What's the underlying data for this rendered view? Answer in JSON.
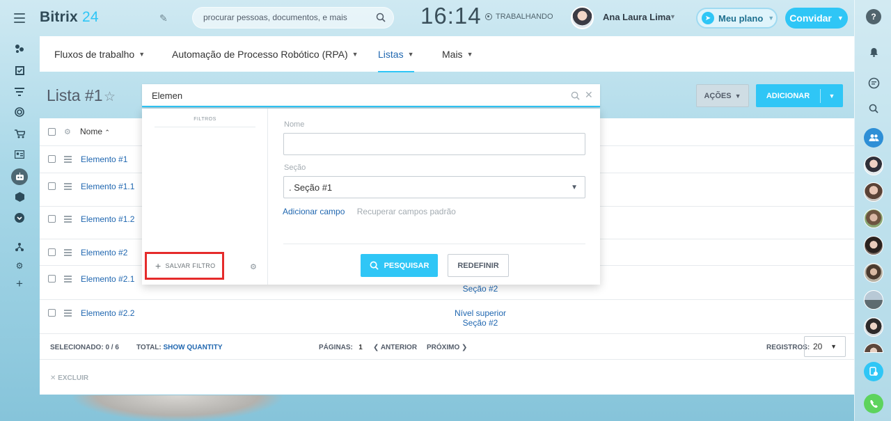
{
  "app": {
    "logo_main": "Bitrix",
    "logo_num": "24"
  },
  "header": {
    "search_placeholder": "procurar pessoas, documentos, e mais",
    "clock": "16:14",
    "work_status": "TRABALHANDO",
    "user_name": "Ana Laura Lima",
    "plan_label": "Meu plano",
    "invite_label": "Convidar"
  },
  "topnav": {
    "tabs": [
      {
        "label": "Fluxos de trabalho"
      },
      {
        "label": "Automação de Processo Robótico (RPA)"
      },
      {
        "label": "Listas"
      },
      {
        "label": "Mais"
      }
    ]
  },
  "page": {
    "title": "Lista #1",
    "actions_label": "AÇÕES",
    "add_label": "ADICIONAR"
  },
  "grid": {
    "column_name": "Nome",
    "rows": [
      {
        "name": "Elemento #1",
        "parent_1": "",
        "parent_2": ""
      },
      {
        "name": "Elemento #1.1",
        "parent_1": "",
        "parent_2": ""
      },
      {
        "name": "Elemento #1.2",
        "parent_1": "",
        "parent_2": ""
      },
      {
        "name": "Elemento #2",
        "parent_1": "",
        "parent_2": ""
      },
      {
        "name": "Elemento #2.1",
        "parent_1": "",
        "parent_2": "Seção #2"
      },
      {
        "name": "Elemento #2.2",
        "parent_1": "Nível superior",
        "parent_2": "Seção #2"
      }
    ],
    "footer": {
      "selected_label": "SELECIONADO:",
      "selected_value": "0 / 6",
      "total_label": "TOTAL:",
      "total_link": "SHOW QUANTITY",
      "pages_label": "PÁGINAS:",
      "pages_value": "1",
      "prev_label": "ANTERIOR",
      "next_label": "PRÓXIMO",
      "records_label": "REGISTROS:",
      "records_value": "20"
    },
    "delete_label": "EXCLUIR"
  },
  "filter": {
    "query": "Elemen",
    "section_title": "FILTROS",
    "save_filter_label": "SALVAR FILTRO",
    "field_name_label": "Nome",
    "field_name_value": "",
    "field_section_label": "Seção",
    "field_section_value": ". Seção #1",
    "add_field_link": "Adicionar campo",
    "restore_fields_link": "Recuperar campos padrão",
    "search_button": "PESQUISAR",
    "reset_button": "REDEFINIR"
  },
  "colors": {
    "accent": "#2fc6f6",
    "link": "#2067b0",
    "highlight_box": "#e52b2b"
  },
  "icons": [
    "menu-icon",
    "pencil-icon",
    "search-icon",
    "star-icon",
    "gear-icon",
    "chevron-down-icon",
    "bell-icon",
    "chat-icon",
    "phone-icon",
    "rocket-icon",
    "close-icon",
    "plus-icon"
  ]
}
